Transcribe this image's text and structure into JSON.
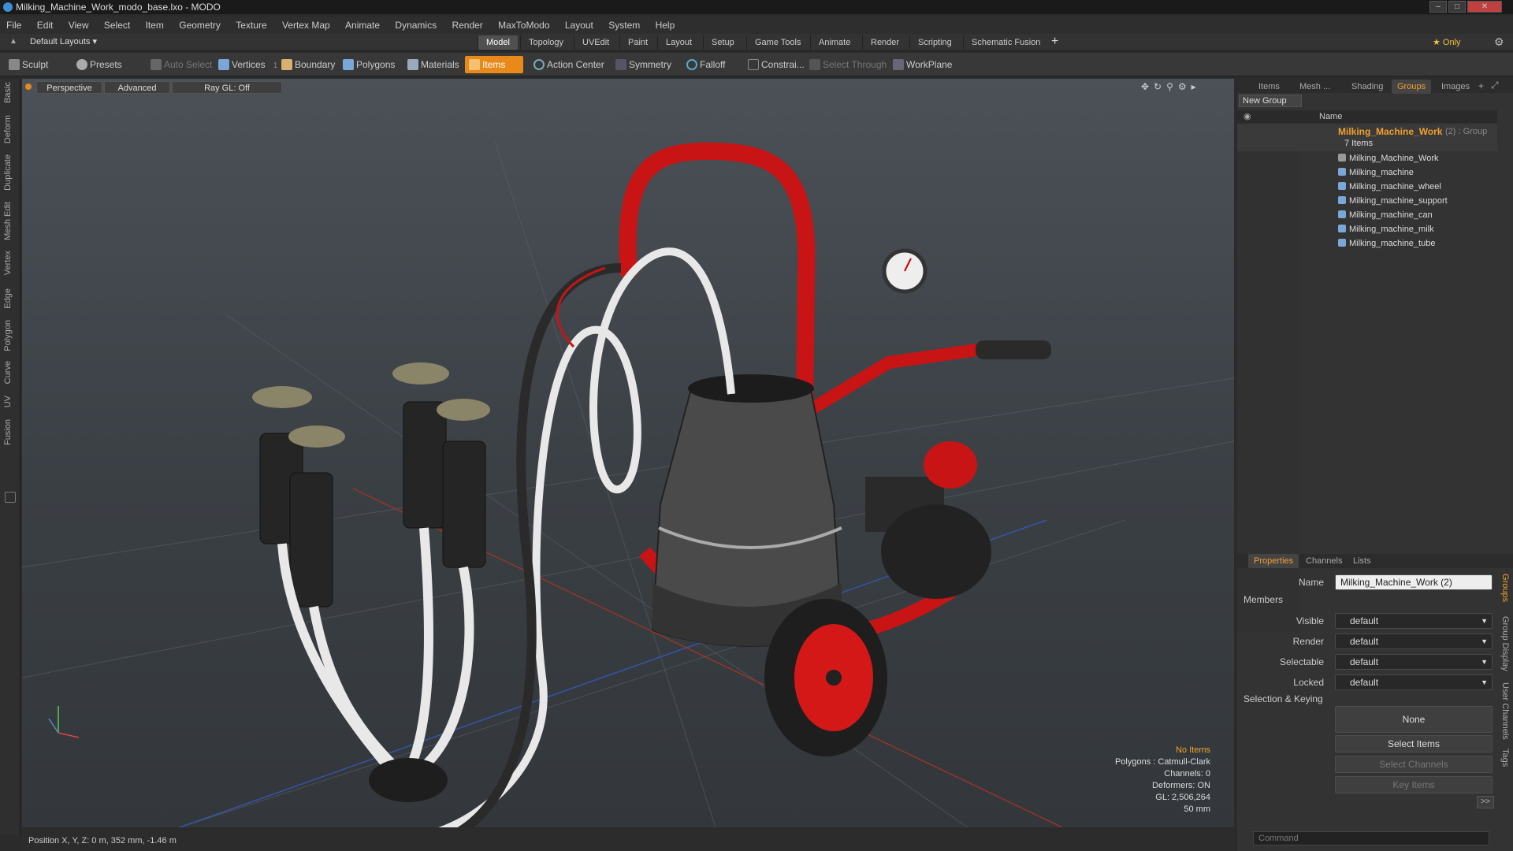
{
  "window": {
    "title": "Milking_Machine_Work_modo_base.lxo - MODO",
    "min": "–",
    "max": "□",
    "close": "✕"
  },
  "menu": [
    "File",
    "Edit",
    "View",
    "Select",
    "Item",
    "Geometry",
    "Texture",
    "Vertex Map",
    "Animate",
    "Dynamics",
    "Render",
    "MaxToModo",
    "Layout",
    "System",
    "Help"
  ],
  "layouts": {
    "current": "Default Layouts ▾",
    "tabs": [
      "Model",
      "Topology",
      "UVEdit",
      "Paint",
      "Layout",
      "Setup",
      "Game Tools",
      "Animate",
      "Render",
      "Scripting",
      "Schematic Fusion"
    ],
    "active": "Model",
    "add": "+",
    "only": "★  Only"
  },
  "toolbar": {
    "sculpt": "Sculpt",
    "presets": "Presets",
    "auto_select": "Auto Select",
    "vertices": "Vertices",
    "vertices_count": "1",
    "boundary": "Boundary",
    "polygons": "Polygons",
    "materials": "Materials",
    "items": "Items",
    "action_center": "Action Center",
    "symmetry": "Symmetry",
    "falloff": "Falloff",
    "constraints": "Constrai...",
    "select_through": "Select Through",
    "workplane": "WorkPlane"
  },
  "left_tabs": [
    "Basic",
    "Deform",
    "Duplicate",
    "Mesh Edit",
    "Vertex",
    "Edge",
    "Polygon",
    "Curve",
    "UV",
    "Fusion"
  ],
  "viewport": {
    "perspective": "Perspective",
    "advanced": "Advanced",
    "raygl": "Ray GL: Off",
    "info": {
      "no_items": "No Items",
      "polygons": "Polygons : Catmull-Clark",
      "channels": "Channels: 0",
      "deformers": "Deformers: ON",
      "gl": "GL: 2,506,264",
      "scale": "50 mm"
    }
  },
  "status": {
    "position": "Position X, Y, Z:  0 m, 352 mm, -1.46 m"
  },
  "right_tabs": [
    "Items",
    "Mesh ...",
    "Shading",
    "Groups",
    "Images"
  ],
  "right_active": "Groups",
  "groups": {
    "new_group": "New Group",
    "col_name": "Name",
    "group_name": "Milking_Machine_Work",
    "group_suffix": "(2) : Group",
    "count": "7 Items",
    "items": [
      "Milking_Machine_Work",
      "Milking_machine",
      "Milking_machine_wheel",
      "Milking_machine_support",
      "Milking_machine_can",
      "Milking_machine_milk",
      "Milking_machine_tube"
    ]
  },
  "props_tabs": [
    "Properties",
    "Channels",
    "Lists"
  ],
  "props": {
    "name_label": "Name",
    "name_value": "Milking_Machine_Work (2)",
    "members": "Members",
    "visible_label": "Visible",
    "render_label": "Render",
    "selectable_label": "Selectable",
    "locked_label": "Locked",
    "default": "default",
    "sel_keying": "Selection & Keying",
    "none": "None",
    "select_items": "Select Items",
    "select_channels": "Select Channels",
    "key_items": "Key Items",
    "more": ">>"
  },
  "right_vtabs": [
    "Groups",
    "Group Display",
    "User Channels",
    "Tags"
  ],
  "command_placeholder": "Command"
}
